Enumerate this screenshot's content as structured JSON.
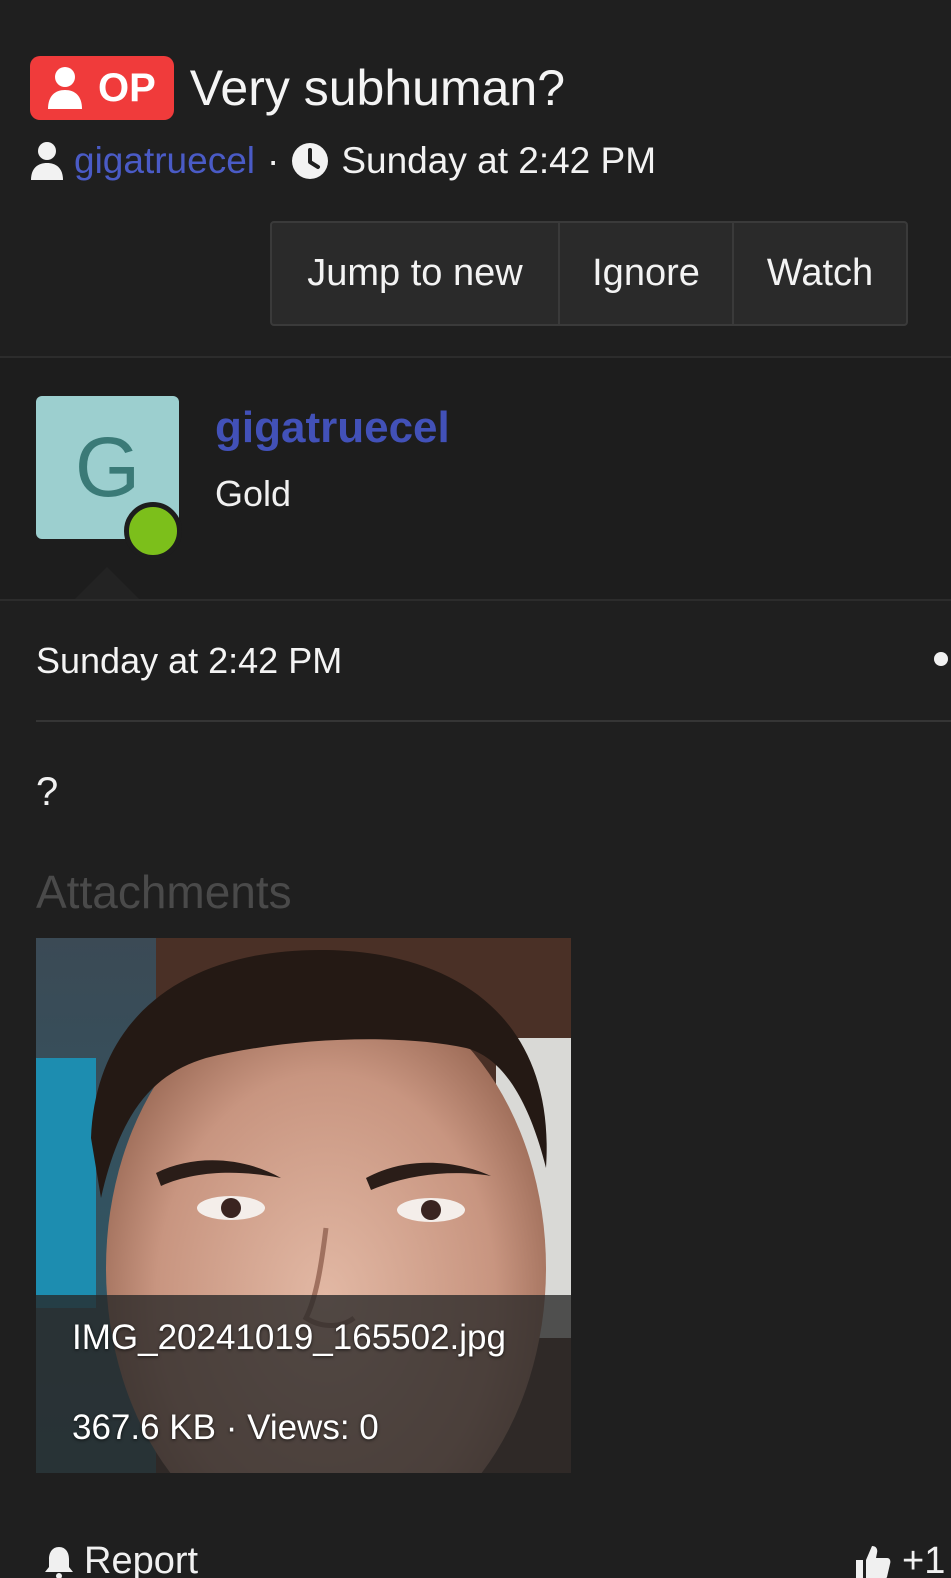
{
  "thread": {
    "badge_label": "OP",
    "title": "Very subhuman?",
    "author": "gigatruecel",
    "separator": "·",
    "date": "Sunday at 2:42 PM"
  },
  "actions": {
    "jump_label": "Jump to new",
    "ignore_label": "Ignore",
    "watch_label": "Watch"
  },
  "user": {
    "avatar_letter": "G",
    "name": "gigatruecel",
    "title": "Gold",
    "status": "online"
  },
  "post": {
    "date": "Sunday at 2:42 PM",
    "body": "?",
    "attachments_heading": "Attachments",
    "attachment": {
      "filename": "IMG_20241019_165502.jpg",
      "meta": "367.6 KB · Views: 0"
    }
  },
  "footer": {
    "report_label": "Report",
    "reaction_label": "+1"
  },
  "colors": {
    "background": "#1f1f1f",
    "badge": "#f03b3b",
    "link": "#4a5bc6",
    "online": "#7cbf1b",
    "avatar_bg": "#9ccfcf"
  },
  "icons": [
    "user-icon",
    "clock-icon",
    "bell-icon",
    "thumbs-up-icon"
  ]
}
